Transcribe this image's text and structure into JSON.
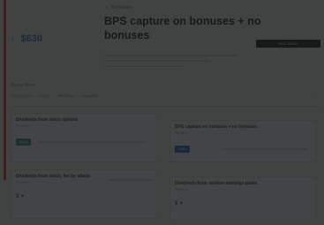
{
  "balance": {
    "amount": "$630",
    "trend_icon": "arrow-up-icon"
  },
  "breadcrumb": {
    "label": "Bonuses"
  },
  "page": {
    "title": "BPS capture on bonuses + no bonuses"
  },
  "header": {
    "action_label": "View details"
  },
  "filters": {
    "label": "Bonus filters",
    "items": [
      "All bonuses",
      "Active",
      "Pending",
      "Captured"
    ]
  },
  "cards": [
    {
      "title": "Dividends from stock options",
      "subtitle": "Pending",
      "tag": "Active"
    },
    {
      "title": "BPS capture on bonuses + no bonuses",
      "subtitle": "Pending",
      "tag": "Active"
    },
    {
      "title": "Dividends from stock, fee by admin",
      "subtitle": "Pending",
      "tag": ""
    },
    {
      "title": "Dividends from random earnings grade",
      "subtitle": "Pending",
      "tag": ""
    }
  ],
  "colors": {
    "accent": "#e8473f",
    "balance": "#3b7fd6",
    "tag_teal": "#3f9a8a",
    "tag_blue": "#3e6fd0"
  }
}
